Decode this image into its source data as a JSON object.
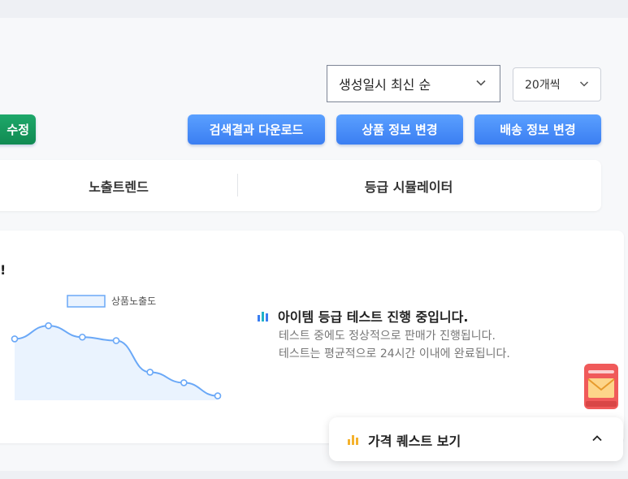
{
  "sort": {
    "order_value": "생성일시 최신 순",
    "count_value": "20개씩"
  },
  "toolbar": {
    "edit_label": "수정",
    "download_label": "검색결과 다운로드",
    "product_label": "상품 정보 변경",
    "shipping_label": "배송 정보 변경",
    "edit_color": "#108a52",
    "primary_color": "#3b7ef2"
  },
  "tabs": [
    {
      "label": "노출트렌드"
    },
    {
      "label": "등급 시뮬레이터"
    }
  ],
  "card": {
    "title_fragment": "!"
  },
  "chart_data": {
    "type": "area",
    "x": [
      1,
      2,
      3,
      4,
      5,
      6,
      7
    ],
    "series": [
      {
        "name": "상품노출도",
        "values": [
          70,
          85,
          72,
          68,
          32,
          20,
          5
        ]
      }
    ],
    "legend": "top",
    "ylim": [
      0,
      100
    ],
    "grid": false,
    "color": "#6aa8f7",
    "fill": "#eaf3fe"
  },
  "notice": {
    "title": "아이템 등급 테스트 진행 중입니다.",
    "line1": "테스트 중에도 정상적으로 판매가 진행됩니다.",
    "line2": "테스트는 평균적으로 24시간 이내에 완료됩니다.",
    "icon": "bar-chart-icon"
  },
  "quest": {
    "label": "가격 퀘스트 보기",
    "icon": "bar-chart-icon",
    "icon_color": "#f4b22d"
  },
  "floating": {
    "icon": "mailbox-icon",
    "color": "#f05a5a"
  }
}
